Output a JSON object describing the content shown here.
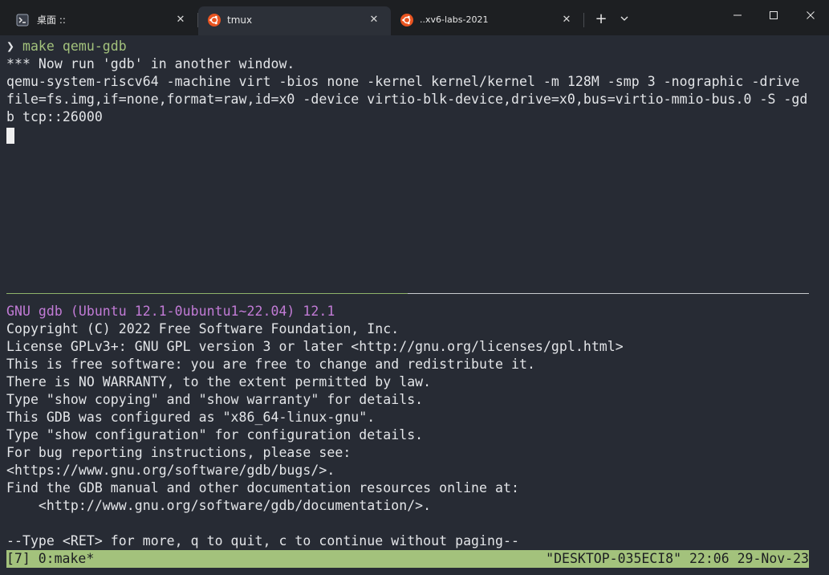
{
  "tabs": [
    {
      "title": "桌面 ::",
      "icon": "powershell-icon",
      "active": false
    },
    {
      "title": "tmux",
      "icon": "ubuntu-icon",
      "active": true
    },
    {
      "title": "..xv6-labs-2021",
      "icon": "ubuntu-icon",
      "active": false
    }
  ],
  "tab_close_glyph": "✕",
  "new_tab_glyph": "+",
  "dropdown_glyph": "⌄",
  "colors": {
    "background": "#272b34",
    "titlebar": "#1d1f22",
    "prompt_command": "#a3c27c",
    "gdb_banner": "#c27bd6",
    "statusbar": "#a3c27c"
  },
  "top_pane": {
    "prompt_symbol": "❯",
    "command": "make qemu-gdb",
    "lines": [
      "*** Now run 'gdb' in another window.",
      "qemu-system-riscv64 -machine virt -bios none -kernel kernel/kernel -m 128M -smp 3 -nographic -drive",
      "file=fs.img,if=none,format=raw,id=x0 -device virtio-blk-device,drive=x0,bus=virtio-mmio-bus.0 -S -gd",
      "b tcp::26000"
    ]
  },
  "bottom_pane": {
    "banner": "GNU gdb (Ubuntu 12.1-0ubuntu1~22.04) 12.1",
    "lines": [
      "Copyright (C) 2022 Free Software Foundation, Inc.",
      "License GPLv3+: GNU GPL version 3 or later <http://gnu.org/licenses/gpl.html>",
      "This is free software: you are free to change and redistribute it.",
      "There is NO WARRANTY, to the extent permitted by law.",
      "Type \"show copying\" and \"show warranty\" for details.",
      "This GDB was configured as \"x86_64-linux-gnu\".",
      "Type \"show configuration\" for configuration details.",
      "For bug reporting instructions, please see:",
      "<https://www.gnu.org/software/gdb/bugs/>.",
      "Find the GDB manual and other documentation resources online at:",
      "    <http://www.gnu.org/software/gdb/documentation/>.",
      "",
      "--Type <RET> for more, q to quit, c to continue without paging--"
    ]
  },
  "status_bar": {
    "left": "[7] 0:make*",
    "right": "\"DESKTOP-035ECI8\" 22:06 29-Nov-23"
  }
}
